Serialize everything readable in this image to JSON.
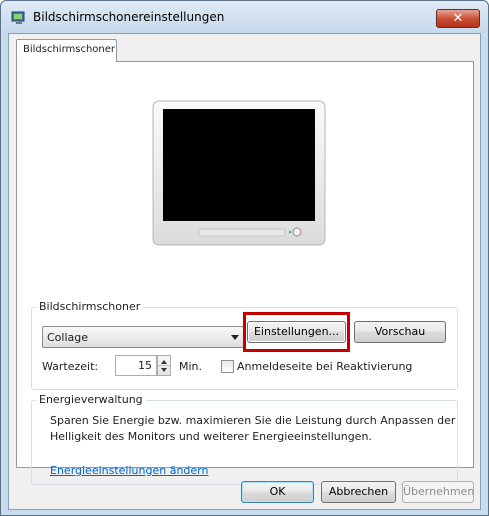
{
  "window": {
    "title": "Bildschirmschonereinstellungen",
    "close_label": "✕"
  },
  "tabs": [
    {
      "label": "Bildschirmschoner",
      "selected": true
    }
  ],
  "screensaver": {
    "group_label": "Bildschirmschoner",
    "selected": "Collage",
    "settings_button": "Einstellungen...",
    "preview_button": "Vorschau",
    "wait_label": "Wartezeit:",
    "wait_value": "15",
    "wait_unit": "Min.",
    "logon_checkbox_label": "Anmeldeseite bei Reaktivierung",
    "logon_checked": false
  },
  "power": {
    "group_label": "Energieverwaltung",
    "description": "Sparen Sie Energie bzw. maximieren Sie die Leistung durch Anpassen der Helligkeit des Monitors und weiterer Energieeinstellungen.",
    "link_label": "Energieeinstellungen ändern"
  },
  "buttons": {
    "ok": "OK",
    "cancel": "Abbrechen",
    "apply": "Übernehmen"
  },
  "colors": {
    "highlight_border": "#c40000",
    "link": "#0066cc"
  }
}
